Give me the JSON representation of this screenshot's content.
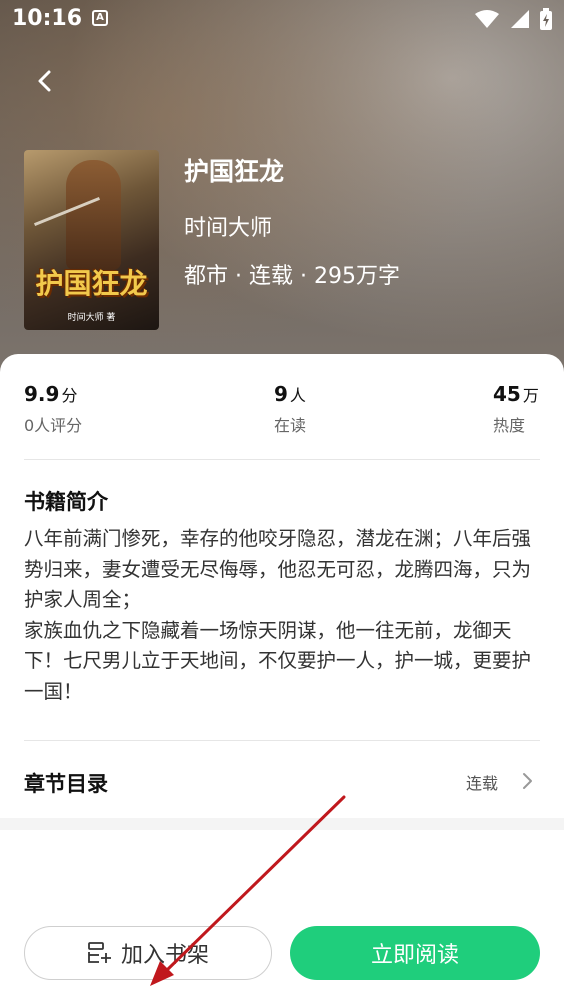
{
  "status_bar": {
    "time": "10:16",
    "notification_letter": "A"
  },
  "book": {
    "title": "护国狂龙",
    "author": "时间大师",
    "meta": "都市 · 连载 · 295万字",
    "cover_title": "护国狂龙",
    "cover_author": "时间大师 著"
  },
  "stats": [
    {
      "value": "9.9",
      "unit": "分",
      "label": "0人评分"
    },
    {
      "value": "9",
      "unit": "人",
      "label": "在读"
    },
    {
      "value": "45",
      "unit": "万",
      "label": "热度"
    }
  ],
  "intro": {
    "heading": "书籍简介",
    "paragraphs": [
      "八年前满门惨死，幸存的他咬牙隐忍，潜龙在渊；八年后强势归来，妻女遭受无尽侮辱，他忍无可忍，龙腾四海，只为护家人周全；",
      "家族血仇之下隐藏着一场惊天阴谋，他一往无前，龙御天下！七尺男儿立于天地间，不仅要护一人，护一城，更要护一国！"
    ]
  },
  "toc": {
    "heading": "章节目录",
    "status": "连载"
  },
  "actions": {
    "add_shelf": "加入书架",
    "read_now": "立即阅读"
  },
  "colors": {
    "accent": "#1fce7c",
    "annotation_arrow": "#c0181d"
  },
  "icons": [
    "back-arrow-icon",
    "wifi-icon",
    "battery-icon",
    "shelf-add-icon",
    "chevron-right-icon"
  ]
}
